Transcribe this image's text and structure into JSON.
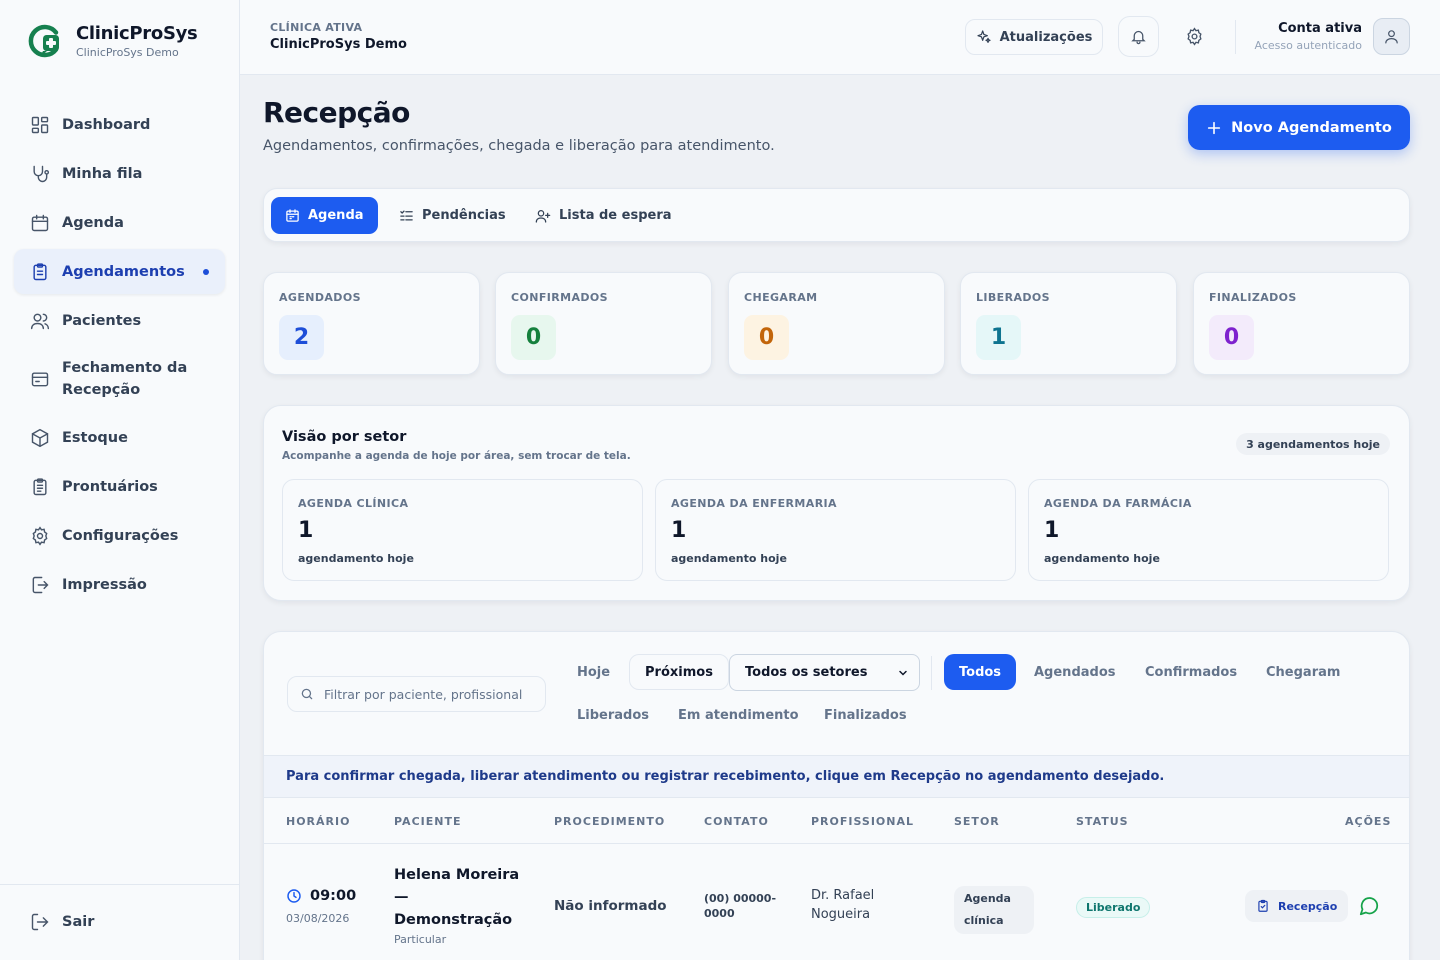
{
  "brand": {
    "name": "ClinicProSys",
    "subtitle": "ClinicProSys Demo",
    "accent": "#16804f"
  },
  "sidebar": {
    "items": [
      {
        "label": "Dashboard",
        "icon": "grid-icon"
      },
      {
        "label": "Minha fila",
        "icon": "stethoscope-icon"
      },
      {
        "label": "Agenda",
        "icon": "calendar-icon"
      },
      {
        "label": "Agendamentos",
        "icon": "clipboard-icon",
        "active": true
      },
      {
        "label": "Pacientes",
        "icon": "users-icon"
      },
      {
        "label": "Fechamento da Recepção",
        "icon": "wallet-icon"
      },
      {
        "label": "Estoque",
        "icon": "box-search-icon"
      },
      {
        "label": "Prontuários",
        "icon": "clipboard-list-icon"
      },
      {
        "label": "Configurações",
        "icon": "gear-icon"
      },
      {
        "label": "Impressão",
        "icon": "export-icon"
      }
    ],
    "logout_label": "Sair"
  },
  "topbar": {
    "clinic_label": "CLÍNICA ATIVA",
    "clinic_name": "ClinicProSys Demo",
    "updates_label": "Atualizações",
    "account_title": "Conta ativa",
    "account_sub": "Acesso autenticado"
  },
  "header": {
    "title": "Recepção",
    "subtitle": "Agendamentos, confirmações, chegada e liberação para atendimento.",
    "new_button": "Novo Agendamento"
  },
  "tabs": [
    {
      "label": "Agenda",
      "active": true
    },
    {
      "label": "Pendências"
    },
    {
      "label": "Lista de espera"
    }
  ],
  "stats": [
    {
      "label": "AGENDADOS",
      "value": "2",
      "bg": "#e6effd",
      "fg": "#1d4ed8"
    },
    {
      "label": "CONFIRMADOS",
      "value": "0",
      "bg": "#e7f7ee",
      "fg": "#15803d"
    },
    {
      "label": "CHEGARAM",
      "value": "0",
      "bg": "#fdf3e2",
      "fg": "#c2650a"
    },
    {
      "label": "LIBERADOS",
      "value": "1",
      "bg": "#e5f7f8",
      "fg": "#0e7490"
    },
    {
      "label": "FINALIZADOS",
      "value": "0",
      "bg": "#f3ebfb",
      "fg": "#7e22ce"
    }
  ],
  "sectors": {
    "title": "Visão por setor",
    "subtitle": "Acompanhe a agenda de hoje por área, sem trocar de tela.",
    "badge": "3 agendamentos hoje",
    "cards": [
      {
        "label": "AGENDA CLÍNICA",
        "count": "1",
        "note": "agendamento hoje"
      },
      {
        "label": "AGENDA DA ENFERMARIA",
        "count": "1",
        "note": "agendamento hoje"
      },
      {
        "label": "AGENDA DA FARMÁCIA",
        "count": "1",
        "note": "agendamento hoje"
      }
    ]
  },
  "filters": {
    "search_placeholder": "Filtrar por paciente, profissional ou procedimento",
    "period": [
      "Hoje",
      "Próximos"
    ],
    "sector_select": "Todos os setores",
    "status": [
      "Todos",
      "Agendados",
      "Confirmados",
      "Chegaram",
      "Liberados",
      "Em atendimento",
      "Finalizados"
    ]
  },
  "info_text": "Para confirmar chegada, liberar atendimento ou registrar recebimento, clique em Recepção no agendamento desejado.",
  "table": {
    "headers": [
      "HORÁRIO",
      "PACIENTE",
      "PROCEDIMENTO",
      "CONTATO",
      "PROFISSIONAL",
      "SETOR",
      "STATUS",
      "AÇÕES"
    ],
    "rows": [
      {
        "time": "09:00",
        "date": "03/08/2026",
        "patient": "Helena Moreira — Demonstração",
        "payment": "Particular",
        "procedure": "Não informado",
        "contact": "(00) 00000-0000",
        "professional": "Dr. Rafael Nogueira",
        "sector": "Agenda clínica",
        "status": "Liberado",
        "action": "Recepção"
      }
    ]
  }
}
